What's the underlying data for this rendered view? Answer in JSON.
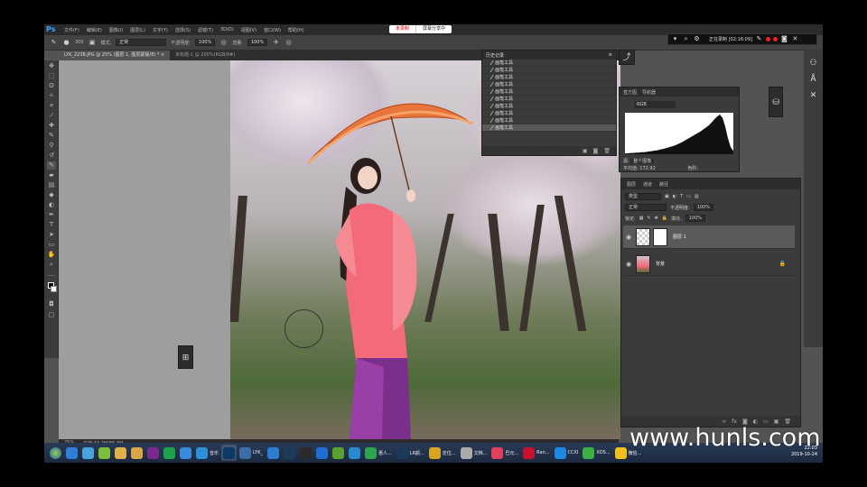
{
  "app": {
    "logo": "Ps"
  },
  "menu": [
    "文件(F)",
    "编辑(E)",
    "图像(I)",
    "图层(L)",
    "文字(Y)",
    "选择(S)",
    "滤镜(T)",
    "3D(D)",
    "视图(V)",
    "窗口(W)",
    "帮助(H)"
  ],
  "recording_center": {
    "status": "未录制",
    "share": "屏幕分享中"
  },
  "options": {
    "brush_size": "300",
    "mode_label": "模式:",
    "mode_value": "正常",
    "opacity_label": "不透明度:",
    "opacity_value": "100%",
    "flow_label": "流量:",
    "flow_value": "100%"
  },
  "recorder": {
    "status": "正在录制 [02:16:09]"
  },
  "tabs": [
    {
      "label": "LYK_2238.JPG @ 25% (图层 1, 图层蒙版/8) * ×"
    },
    {
      "label": "未标题-1 @ 200%(RGB/8#)"
    }
  ],
  "status_bar": {
    "zoom": "25%",
    "doc": "文档:43.2M/86.3M"
  },
  "history": {
    "title": "历史记录",
    "step_label": "画笔工具",
    "steps": 10,
    "selected": 10
  },
  "histogram": {
    "tabs": [
      "直方图",
      "导航器"
    ],
    "channel": "RGB",
    "source_label": "源:",
    "source_value": "整个图像",
    "stat_label": "平均值:",
    "stat_value": "172.92",
    "extra_label": "色阶:",
    "shape": [
      2,
      2,
      3,
      3,
      4,
      4,
      5,
      5,
      6,
      7,
      8,
      9,
      10,
      12,
      13,
      15,
      17,
      19,
      21,
      24,
      27,
      30,
      34,
      38,
      42,
      46,
      50,
      54,
      58,
      63,
      68,
      73,
      80,
      88,
      95,
      100,
      92,
      70,
      40,
      18,
      8
    ]
  },
  "layers": {
    "tabs": [
      "图层",
      "通道",
      "路径"
    ],
    "filter": "类型",
    "blend": "正常",
    "opacity_label": "不透明度:",
    "opacity_value": "100%",
    "lock_label": "锁定:",
    "fill_label": "填充:",
    "fill_value": "100%",
    "items": [
      {
        "name": "图层 1",
        "selected": true
      },
      {
        "name": "背景",
        "selected": false
      }
    ]
  },
  "taskbar": {
    "items": [
      {
        "label": "",
        "color": "#2f7fd6"
      },
      {
        "label": "",
        "color": "#4aa3df"
      },
      {
        "label": "",
        "color": "#7bbf3a"
      },
      {
        "label": "",
        "color": "#e0b04a"
      },
      {
        "label": "",
        "color": "#d8a548"
      },
      {
        "label": "",
        "color": "#7a2a8c"
      },
      {
        "label": "",
        "color": "#1aa34a"
      },
      {
        "label": "",
        "color": "#3b8ad9"
      },
      {
        "label": "音乐",
        "color": "#2d8fd6"
      },
      {
        "label": "",
        "color": "#0b3a66",
        "active": true
      },
      {
        "label": "LYK_",
        "color": "#3a6ea5"
      },
      {
        "label": "",
        "color": "#2c7cd2"
      },
      {
        "label": "",
        "color": "#1c3a5a"
      },
      {
        "label": "",
        "color": "#2b2b2b"
      },
      {
        "label": "",
        "color": "#1e6fd0"
      },
      {
        "label": "",
        "color": "#5aa130"
      },
      {
        "label": "",
        "color": "#2a8ad0"
      },
      {
        "label": "惠人...",
        "color": "#2da44e"
      },
      {
        "label": "LR颜...",
        "color": "#1c3a5a"
      },
      {
        "label": "定位...",
        "color": "#d9a520"
      },
      {
        "label": "文档...",
        "color": "#aaa"
      },
      {
        "label": "巴元...",
        "color": "#e04060"
      },
      {
        "label": "Ran...",
        "color": "#c8102e"
      },
      {
        "label": "CCXI",
        "color": "#1e88e5"
      },
      {
        "label": "XDS...",
        "color": "#3cb043"
      },
      {
        "label": "微信...",
        "color": "#f0c020"
      }
    ],
    "time": "22:03",
    "date": "2019-10-24"
  },
  "watermark": "www.hunls.com"
}
